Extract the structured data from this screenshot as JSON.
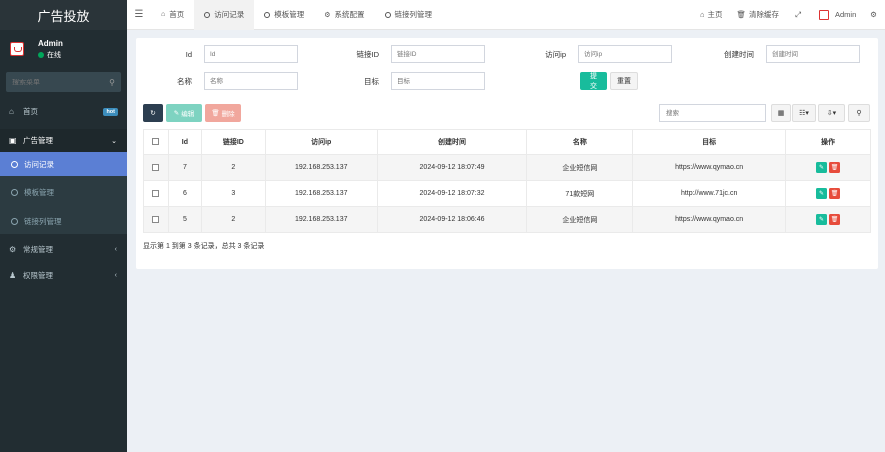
{
  "brand": "广告投放",
  "user": {
    "name": "Admin",
    "status": "在线"
  },
  "sidebar_search": {
    "placeholder": "搜索菜单"
  },
  "menu": {
    "home": {
      "label": "首页",
      "badge": "hot"
    },
    "ads": {
      "label": "广告管理"
    },
    "ads_sub": [
      {
        "label": "访问记录"
      },
      {
        "label": "模板管理"
      },
      {
        "label": "链接列管理"
      }
    ],
    "system": {
      "label": "常规管理"
    },
    "perm": {
      "label": "权限管理"
    }
  },
  "topbar": {
    "tabs": [
      {
        "label": "首页"
      },
      {
        "label": "访问记录"
      },
      {
        "label": "模板管理"
      },
      {
        "label": "系统配置"
      },
      {
        "label": "链接列管理"
      }
    ],
    "home_link": "主页",
    "clear_cache": "清除缓存",
    "admin": "Admin"
  },
  "filters": {
    "id": {
      "label": "Id",
      "placeholder": "Id"
    },
    "link_id": {
      "label": "链接ID",
      "placeholder": "链接ID"
    },
    "ip": {
      "label": "访问ip",
      "placeholder": "访问ip"
    },
    "created": {
      "label": "创建时间",
      "placeholder": "创建时间"
    },
    "name": {
      "label": "名称",
      "placeholder": "名称"
    },
    "target": {
      "label": "目标",
      "placeholder": "目标"
    },
    "submit": "提交",
    "reset": "重置"
  },
  "toolbar": {
    "edit": "编辑",
    "delete": "删除",
    "search_placeholder": "搜索"
  },
  "table": {
    "headers": [
      "Id",
      "链接ID",
      "访问ip",
      "创建时间",
      "名称",
      "目标",
      "操作"
    ],
    "rows": [
      {
        "id": "7",
        "link_id": "2",
        "ip": "192.168.253.137",
        "time": "2024-09-12 18:07:49",
        "name": "企业短信网",
        "target": "https://www.qymao.cn"
      },
      {
        "id": "6",
        "link_id": "3",
        "ip": "192.168.253.137",
        "time": "2024-09-12 18:07:32",
        "name": "71款短网",
        "target": "http://www.71jc.cn"
      },
      {
        "id": "5",
        "link_id": "2",
        "ip": "192.168.253.137",
        "time": "2024-09-12 18:06:46",
        "name": "企业短信网",
        "target": "https://www.qymao.cn"
      }
    ]
  },
  "summary": "显示第 1 到第 3 条记录，总共 3 条记录",
  "colors": {
    "sidebar": "#222d32",
    "active": "#5b7fd4",
    "green": "#18bc9c",
    "red": "#e74c3c"
  }
}
